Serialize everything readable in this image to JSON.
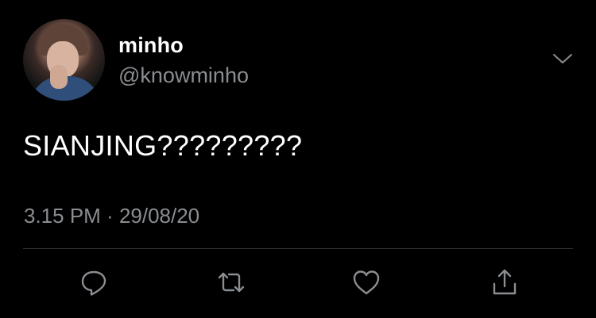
{
  "tweet": {
    "author_name": "minho",
    "author_handle": "@knowminho",
    "text": "SIANJING?????????",
    "time": "3.15 PM",
    "separator": " · ",
    "date": "29/08/20"
  },
  "icons": {
    "menu": "chevron-down-icon",
    "reply": "reply-icon",
    "retweet": "retweet-icon",
    "like": "heart-icon",
    "share": "share-icon"
  },
  "colors": {
    "background": "#000000",
    "primary_text": "#ffffff",
    "secondary_text": "#8a8d91",
    "icon": "#8a8d91",
    "divider": "#2f3336"
  }
}
